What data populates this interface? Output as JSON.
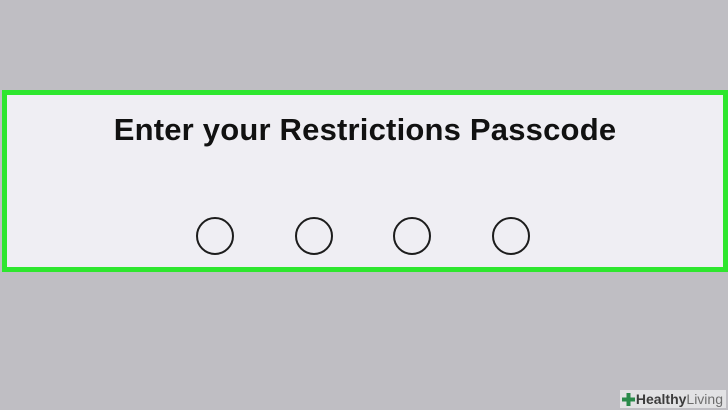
{
  "passcode_prompt": {
    "title": "Enter your Restrictions Passcode",
    "digits_entered": 0,
    "digits_total": 4
  },
  "watermark": {
    "part1": "Healthy",
    "part2": "Living"
  },
  "colors": {
    "highlight_border": "#2ee62e",
    "panel_background": "#efeef3",
    "page_background": "#bfbec3"
  }
}
